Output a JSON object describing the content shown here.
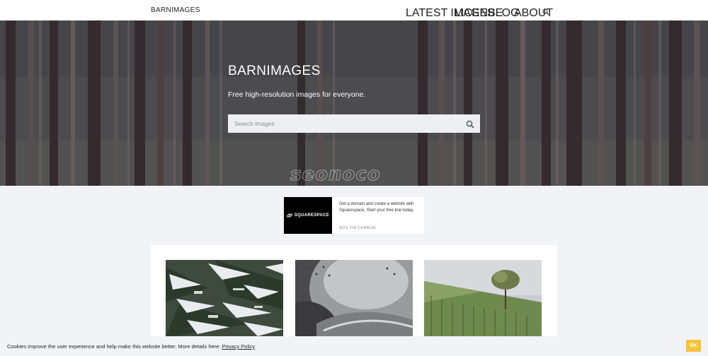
{
  "header": {
    "brand": "BARNIMAGES",
    "nav": [
      "LATEST IMAGES",
      "LICENSE",
      "BLOG",
      "ABOUT"
    ],
    "search_icon": "search-icon"
  },
  "hero": {
    "title": "BARNIMAGES",
    "subtitle": "Free high-resolution images for everyone.",
    "search_placeholder": "Search images",
    "watermark": "seonoco"
  },
  "ad": {
    "logo_text": "SQUARESPACE",
    "text": "Get a domain and create a website with Squarespace. Start your free trial today.",
    "via": "ADS VIA CARBON"
  },
  "gallery": {
    "images": [
      "snowy-pine-branches",
      "metal-armor",
      "vineyard-tree"
    ]
  },
  "cookie": {
    "text": "Cookies improve the user experience and help make this website better. More details here: ",
    "link": "Privacy Policy",
    "ok": "OK"
  },
  "colors": {
    "accent": "#f5c43a",
    "header_bg": "#ffffff",
    "page_bg": "#f2f3f7"
  }
}
